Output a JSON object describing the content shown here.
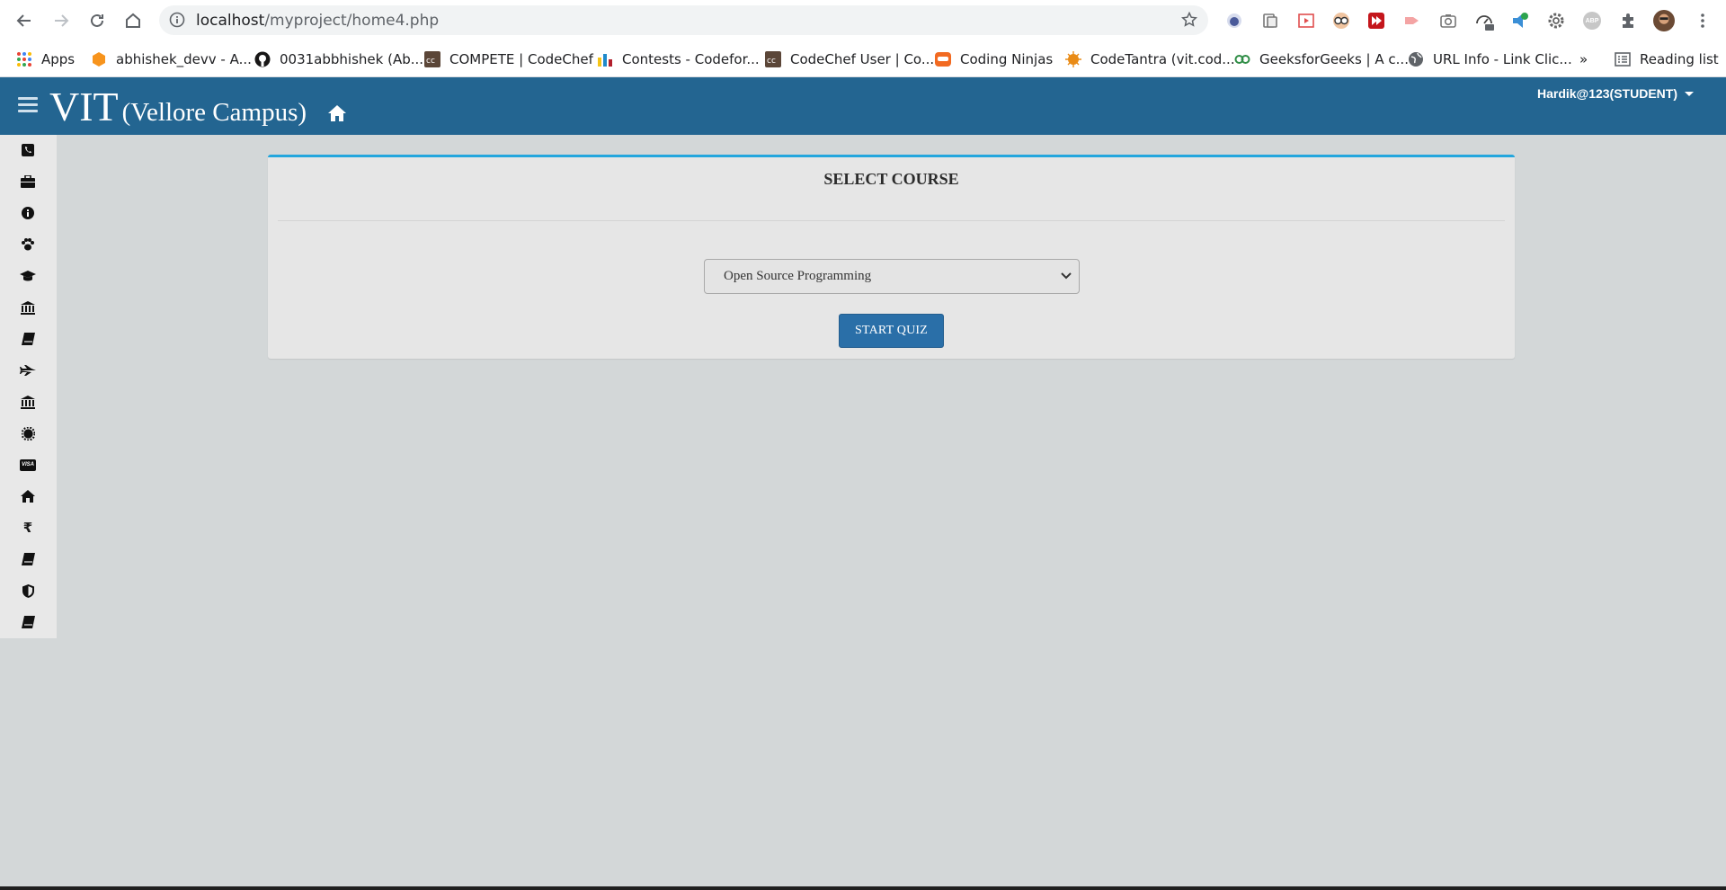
{
  "browser": {
    "url_host": "localhost",
    "url_path": "/myproject/home4.php",
    "bookmarks": [
      "Apps",
      "abhishek_devv - A...",
      "0031abbhishek (Ab...",
      "COMPETE | CodeChef",
      "Contests - Codefor...",
      "CodeChef User | Co...",
      "Coding Ninjas",
      "CodeTantra (vit.cod...",
      "GeeksforGeeks | A c...",
      "URL Info - Link Clic..."
    ],
    "more_bookmarks": "»",
    "reading_list": "Reading list",
    "extensions": [
      "ext-1-icon",
      "ext-2-icon",
      "ext-3-icon",
      "ext-4-icon",
      "ext-5-icon",
      "ext-6-icon",
      "screenshot-icon",
      "speedometer-icon",
      "ext-9-icon",
      "settings-icon",
      "adblock-icon",
      "puzzle-icon"
    ],
    "extension_badge_text": "ABP"
  },
  "header": {
    "brand": "VIT",
    "campus": "(Vellore Campus)",
    "user": "Hardik@123(STUDENT)"
  },
  "sidebar": {
    "icons": [
      "phone-icon",
      "briefcase-icon",
      "info-icon",
      "paw-icon",
      "graduation-cap-icon",
      "bank-icon",
      "book-icon",
      "plane-icon",
      "bank-icon",
      "gear-badge-icon",
      "visa-icon",
      "home-icon",
      "rupee-icon",
      "book-icon",
      "shield-icon",
      "book-icon"
    ],
    "rupee_glyph": "₹",
    "visa_text": "VISA"
  },
  "main": {
    "title": "SELECT COURSE",
    "course_selected": "Open Source Programming",
    "start_button": "START QUIZ"
  },
  "colors": {
    "header": "#236591",
    "panel_accent": "#23a6dd",
    "button": "#2a6fa8",
    "page_bg": "#d3d7d8"
  }
}
